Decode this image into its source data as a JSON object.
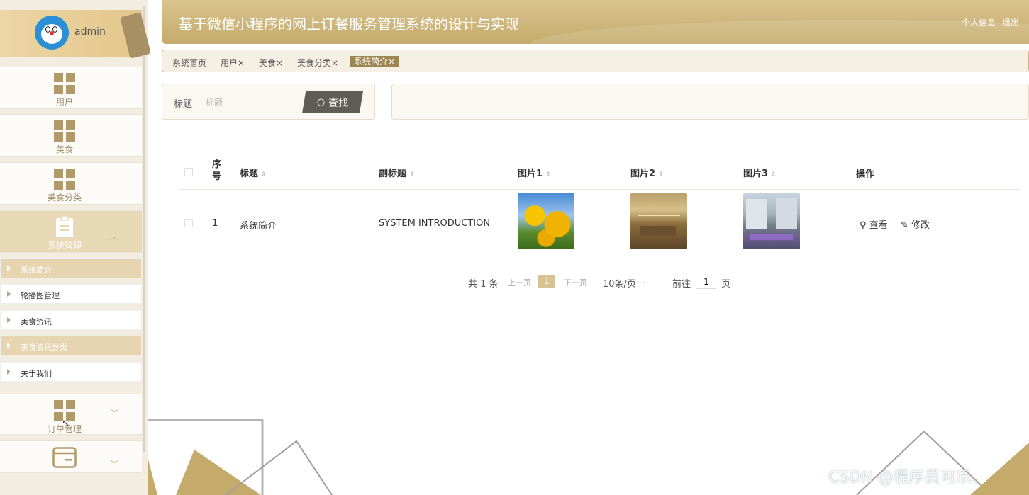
{
  "sidebar": {
    "username": "admin",
    "menus": [
      {
        "label": "用户"
      },
      {
        "label": "美食"
      },
      {
        "label": "美食分类"
      },
      {
        "label": "系统管理"
      },
      {
        "label": "订单管理"
      }
    ],
    "sub_items": [
      {
        "label": "系统简介"
      },
      {
        "label": "轮播图管理"
      },
      {
        "label": "美食资讯"
      },
      {
        "label": "美食资讯分类"
      },
      {
        "label": "关于我们"
      }
    ]
  },
  "header": {
    "title": "基于微信小程序的网上订餐服务管理系统的设计与实现",
    "profile": "个人信息",
    "logout": "退出"
  },
  "tabs": [
    "系统首页",
    "用户×",
    "美食×",
    "美食分类×",
    "系统简介×"
  ],
  "search": {
    "label": "标题",
    "placeholder": "标题",
    "button": "查找"
  },
  "table": {
    "headers": [
      "序号",
      "标题",
      "副标题",
      "图片1",
      "图片2",
      "图片3",
      "操作"
    ],
    "rows": [
      {
        "index": "1",
        "title": "系统简介",
        "subtitle": "SYSTEM INTRODUCTION",
        "view": "查看",
        "edit": "修改"
      }
    ]
  },
  "pagination": {
    "total": "共 1 条",
    "prev": "上一页",
    "current": "1",
    "next": "下一页",
    "page_size": "10条/页",
    "goto": "前往",
    "goto_value": "1",
    "page_suffix": "页"
  },
  "watermark": "CSDN @程序员可乐、",
  "colors": {
    "accent": "#c4ab6c",
    "sidebar_bg": "#f3ece1",
    "active_tab": "#9d8651",
    "button_dark": "#5f5d58"
  }
}
